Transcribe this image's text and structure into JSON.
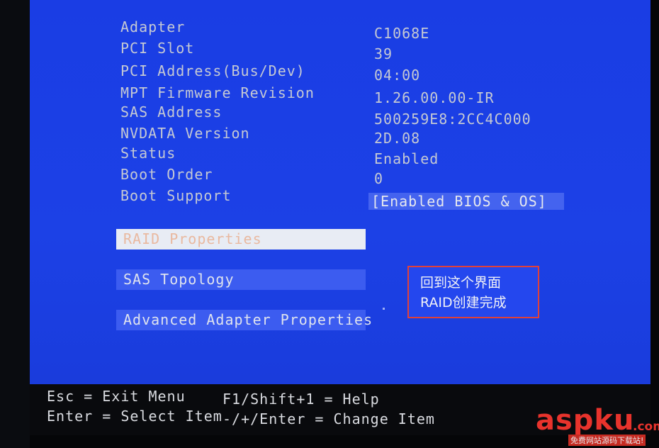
{
  "info_rows": [
    {
      "label": "Adapter",
      "value": "C1068E"
    },
    {
      "label": "PCI Slot",
      "value": "39"
    },
    {
      "label": "PCI Address(Bus/Dev)",
      "value": "04:00"
    },
    {
      "label": "MPT Firmware Revision",
      "value": "1.26.00.00-IR"
    },
    {
      "label": "SAS Address",
      "value": "500259E8:2CC4C000"
    },
    {
      "label": "NVDATA Version",
      "value": "2D.08"
    },
    {
      "label": "Status",
      "value": "Enabled"
    },
    {
      "label": "Boot Order",
      "value": "0"
    },
    {
      "label": "Boot Support",
      "value": "[Enabled BIOS & OS]"
    }
  ],
  "menu": [
    {
      "label": "RAID Properties",
      "selected": true
    },
    {
      "label": "SAS Topology",
      "selected": false
    },
    {
      "label": "Advanced Adapter Properties",
      "selected": false
    }
  ],
  "annotation": {
    "line1": "回到这个界面",
    "line2": "RAID创建完成",
    "border_color": "#e0413a"
  },
  "footer": {
    "esc": "Esc = Exit Menu",
    "enter": "Enter = Select Item",
    "help": "F1/Shift+1 = Help",
    "change": "-/+/Enter = Change Item"
  },
  "watermark": {
    "brand": "aspku",
    "tld": ".com",
    "tagline": "免费网站源码下载站!"
  },
  "colors": {
    "screen_blue": "#1b3fe0",
    "text_gray": "#c5c9d3",
    "highlight_bar": "#e8ecf4",
    "brand_red": "#e8332c"
  }
}
